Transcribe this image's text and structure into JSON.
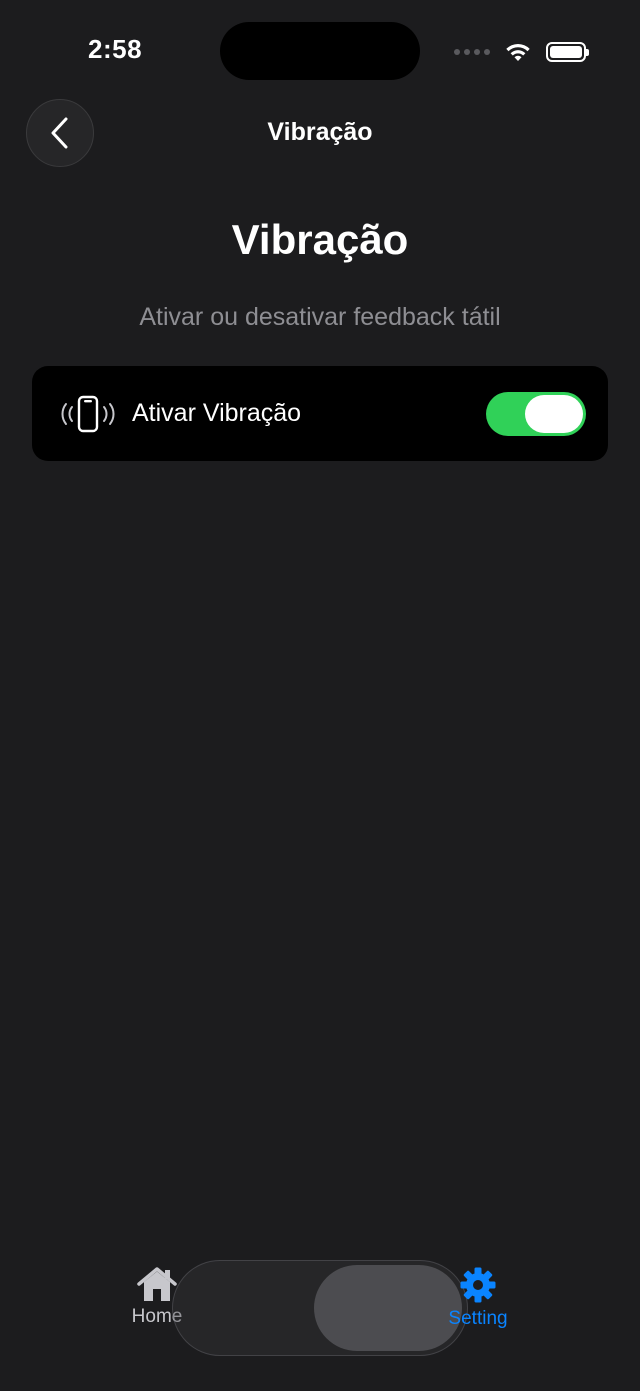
{
  "status_bar": {
    "time": "2:58"
  },
  "nav": {
    "title": "Vibração",
    "back_icon": "chevron-left-icon"
  },
  "page": {
    "title": "Vibração",
    "subtitle": "Ativar ou desativar feedback tátil"
  },
  "setting": {
    "icon": "phone-vibration-icon",
    "label": "Ativar Vibração",
    "enabled": true,
    "toggle_color": "#30d158"
  },
  "tab_bar": {
    "items": [
      {
        "label": "Home",
        "icon": "house-icon",
        "selected": false
      },
      {
        "label": "Setting",
        "icon": "gear-icon",
        "selected": true
      }
    ],
    "accent_color": "#0a84ff"
  }
}
